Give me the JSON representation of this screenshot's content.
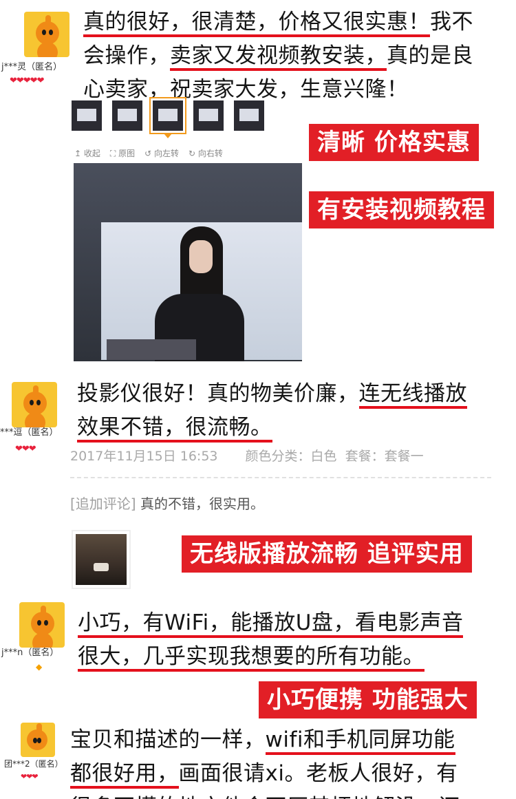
{
  "reviews": [
    {
      "username": "j***灵（匿名）",
      "rating_icons": "❤❤❤❤❤",
      "lines": [
        [
          {
            "t": "真的很好，很清楚，价格又很实惠！",
            "u": true
          },
          {
            "t": "我不",
            "u": false
          }
        ],
        [
          {
            "t": "会操作，",
            "u": false
          },
          {
            "t": "卖家又发视频教安装，",
            "u": true
          },
          {
            "t": "真的是良",
            "u": false
          }
        ],
        [
          {
            "t": "心卖家，祝卖家大发，生意兴隆！",
            "u": false
          }
        ]
      ]
    },
    {
      "username": "***逗（匿名）",
      "rating_icons": "❤❤❤",
      "lines": [
        [
          {
            "t": "投影仪很好！真的物美价廉，",
            "u": false
          },
          {
            "t": "连无线播放",
            "u": true
          }
        ],
        [
          {
            "t": "效果不错，很流畅。",
            "u": true
          }
        ]
      ],
      "date": "2017年11月15日 16:53",
      "color_class": "颜色分类：白色",
      "package": "套餐：套餐一",
      "append_label": "[追加评论]",
      "append_text": "真的不错，很实用。"
    },
    {
      "username": "j***n（匿名）",
      "rating_icons": "◆",
      "lines": [
        [
          {
            "t": "小巧，有WiFi，能播放U盘，看电影声音",
            "u": true
          }
        ],
        [
          {
            "t": "很大，几乎实现我想要的所有功能。",
            "u": true
          }
        ]
      ]
    },
    {
      "username": "团***2（匿名）",
      "rating_icons": "❤❤❤",
      "lines": [
        [
          {
            "t": "宝贝和描述的一样，",
            "u": false
          },
          {
            "t": "wifi和手机同屏功能",
            "u": true
          }
        ],
        [
          {
            "t": "都很好用，",
            "u": true
          },
          {
            "t": "画面很请xi。老板人很好，有",
            "u": false
          }
        ],
        [
          {
            "t": "很多不懂的地方他会不厌其烦地解没，还",
            "u": false
          }
        ]
      ]
    }
  ],
  "tags": {
    "t1": "清晰 价格实惠",
    "t2": "有安装视频教程",
    "t3": "无线版播放流畅 追评实用",
    "t4": "小巧便携 功能强大"
  },
  "viewer": {
    "collapse": "收起",
    "original": "原图",
    "rotate_left": "向左转",
    "rotate_right": "向右转"
  },
  "colors": {
    "accent_red": "#e21f26",
    "underline_red": "#e4101c",
    "thumb_active": "#f29a1c"
  }
}
